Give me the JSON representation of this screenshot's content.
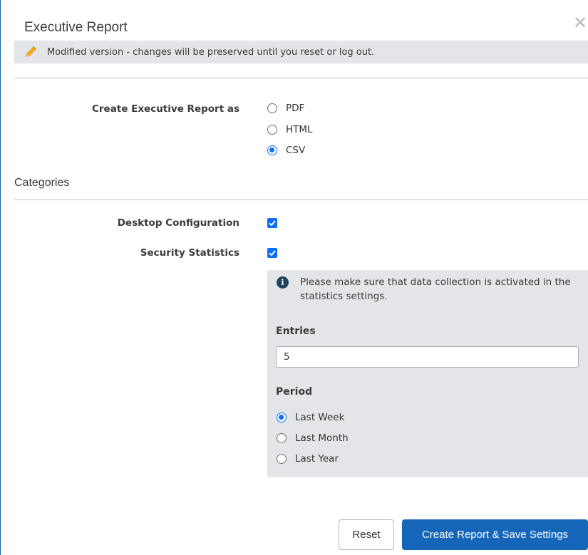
{
  "dialog": {
    "title": "Executive Report",
    "close_glyph": "✕",
    "notice": "Modified version - changes will be preserved until you reset or log out."
  },
  "format": {
    "label": "Create Executive Report as",
    "options": [
      {
        "label": "PDF",
        "checked": false
      },
      {
        "label": "HTML",
        "checked": false
      },
      {
        "label": "CSV",
        "checked": true
      }
    ]
  },
  "categories": {
    "title": "Categories",
    "desktop_configuration": {
      "label": "Desktop Configuration",
      "checked": true
    },
    "security_statistics": {
      "label": "Security Statistics",
      "checked": true
    }
  },
  "statistics_panel": {
    "info": "Please make sure that data collection is activated in the statistics settings.",
    "entries_label": "Entries",
    "entries_value": "5",
    "period_label": "Period",
    "periods": [
      {
        "label": "Last Week",
        "checked": true
      },
      {
        "label": "Last Month",
        "checked": false
      },
      {
        "label": "Last Year",
        "checked": false
      }
    ]
  },
  "buttons": {
    "reset": "Reset",
    "create": "Create Report & Save Settings"
  },
  "colors": {
    "accent": "#0d6efd",
    "primary_button": "#1565b8",
    "panel_bg": "#e3e5e8",
    "notice_pencil": "#f0a81c"
  }
}
